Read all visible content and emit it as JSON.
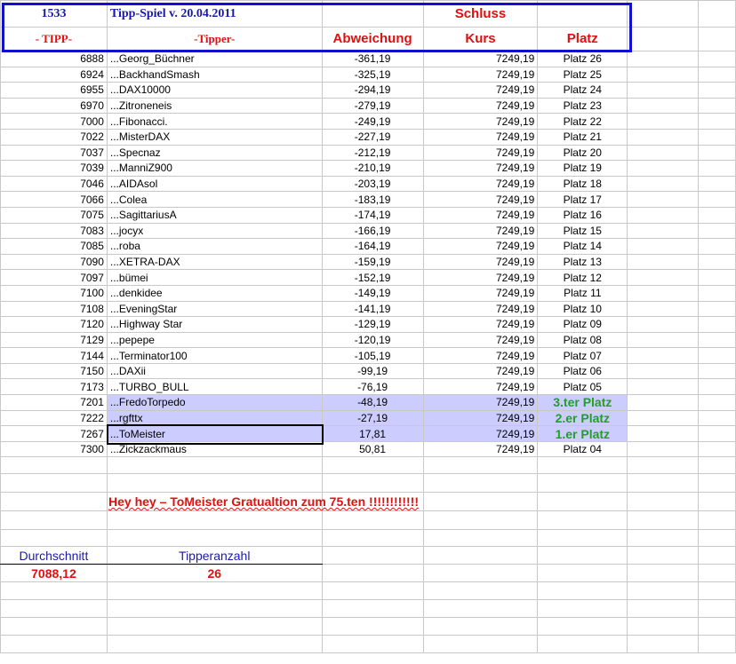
{
  "header": {
    "count": "1533",
    "title": "Tipp-Spiel v. 20.04.2011",
    "schluss": "Schluss",
    "col_tipp": "- TIPP-",
    "col_tipper": "-Tipper-",
    "col_abweichung": "Abweichung",
    "col_kurs": "Kurs",
    "col_platz": "Platz"
  },
  "rows": [
    [
      "6888",
      "...Georg_Büchner",
      "-361,19",
      "7249,19",
      "Platz 26"
    ],
    [
      "6924",
      "...BackhandSmash",
      "-325,19",
      "7249,19",
      "Platz 25"
    ],
    [
      "6955",
      "...DAX10000",
      "-294,19",
      "7249,19",
      "Platz 24"
    ],
    [
      "6970",
      "...Zitroneneis",
      "-279,19",
      "7249,19",
      "Platz 23"
    ],
    [
      "7000",
      "...Fibonacci.",
      "-249,19",
      "7249,19",
      "Platz 22"
    ],
    [
      "7022",
      "...MisterDAX",
      "-227,19",
      "7249,19",
      "Platz 21"
    ],
    [
      "7037",
      "...Specnaz",
      "-212,19",
      "7249,19",
      "Platz 20"
    ],
    [
      "7039",
      "...ManniZ900",
      "-210,19",
      "7249,19",
      "Platz 19"
    ],
    [
      "7046",
      "...AIDAsol",
      "-203,19",
      "7249,19",
      "Platz 18"
    ],
    [
      "7066",
      "...Colea",
      "-183,19",
      "7249,19",
      "Platz 17"
    ],
    [
      "7075",
      "...SagittariusA",
      "-174,19",
      "7249,19",
      "Platz 16"
    ],
    [
      "7083",
      "...jocyx",
      "-166,19",
      "7249,19",
      "Platz 15"
    ],
    [
      "7085",
      "...roba",
      "-164,19",
      "7249,19",
      "Platz 14"
    ],
    [
      "7090",
      "...XETRA-DAX",
      "-159,19",
      "7249,19",
      "Platz 13"
    ],
    [
      "7097",
      "...bümei",
      "-152,19",
      "7249,19",
      "Platz 12"
    ],
    [
      "7100",
      "...denkidee",
      "-149,19",
      "7249,19",
      "Platz 11"
    ],
    [
      "7108",
      "...EveningStar",
      "-141,19",
      "7249,19",
      "Platz 10"
    ],
    [
      "7120",
      "...Highway Star",
      "-129,19",
      "7249,19",
      "Platz 09"
    ],
    [
      "7129",
      "...pepepe",
      "-120,19",
      "7249,19",
      "Platz 08"
    ],
    [
      "7144",
      "...Terminator100",
      "-105,19",
      "7249,19",
      "Platz 07"
    ],
    [
      "7150",
      "...DAXii",
      "-99,19",
      "7249,19",
      "Platz 06"
    ],
    [
      "7173",
      "...TURBO_BULL",
      "-76,19",
      "7249,19",
      "Platz 05"
    ],
    [
      "7201",
      "...FredoTorpedo",
      "-48,19",
      "7249,19",
      "3.ter Platz"
    ],
    [
      "7222",
      "...rgfttx",
      "-27,19",
      "7249,19",
      "2.er Platz"
    ],
    [
      "7267",
      "...ToMeister",
      "17,81",
      "7249,19",
      "1.er Platz"
    ],
    [
      "7300",
      "...Zickzackmaus",
      "50,81",
      "7249,19",
      "Platz 04"
    ]
  ],
  "highlighted": [
    22,
    23,
    24
  ],
  "message": "Hey hey – ToMeister Gratualtion zum 75.ten !!!!!!!!!!!!",
  "footer": {
    "avg_label": "Durchschnitt",
    "avg_value": "7088,12",
    "count_label": "Tipperanzahl",
    "count_value": "26"
  }
}
